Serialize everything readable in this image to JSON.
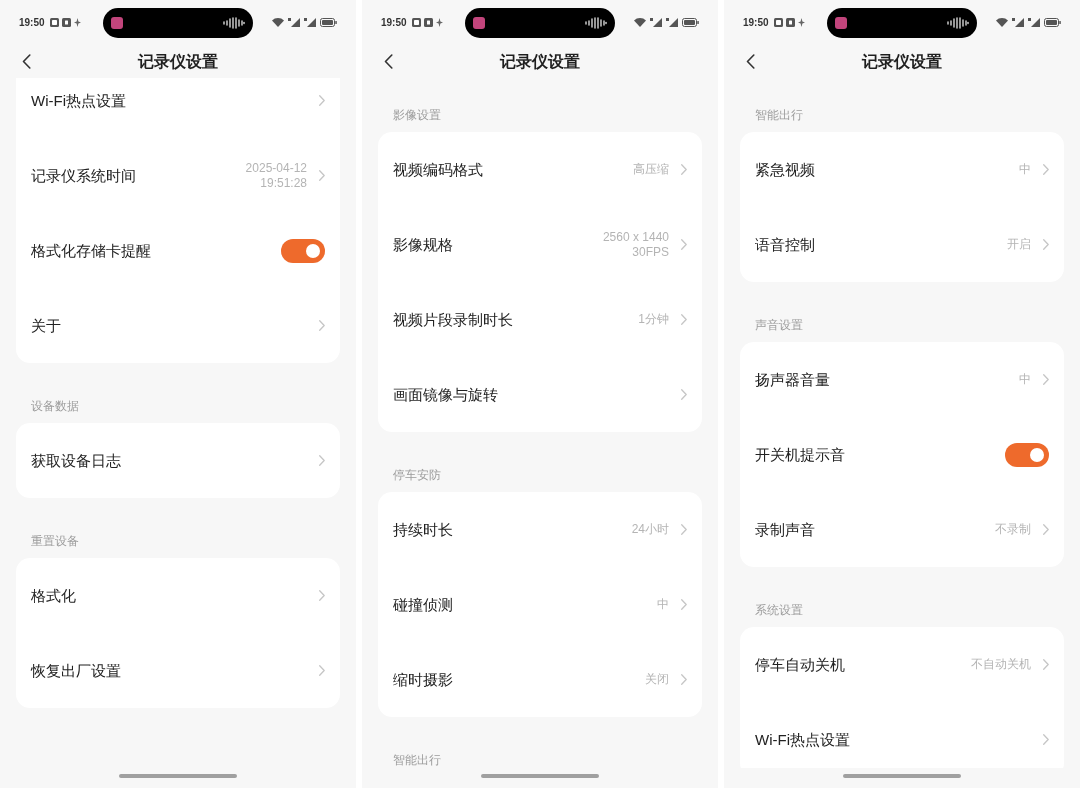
{
  "screens": [
    {
      "status_bar": {
        "time": "19:50"
      },
      "header": {
        "title": "记录仪设置"
      },
      "sections": [
        {
          "continued": true,
          "items": [
            {
              "kind": "link",
              "label": "Wi-Fi热点设置"
            },
            {
              "kind": "link",
              "label": "记录仪系统时间",
              "value": "2025-04-12\n19:51:28"
            },
            {
              "kind": "toggle",
              "label": "格式化存储卡提醒",
              "on": true
            },
            {
              "kind": "link",
              "label": "关于"
            }
          ]
        },
        {
          "title": "设备数据",
          "items": [
            {
              "kind": "link",
              "label": "获取设备日志"
            }
          ]
        },
        {
          "title": "重置设备",
          "items": [
            {
              "kind": "link",
              "label": "格式化"
            },
            {
              "kind": "link",
              "label": "恢复出厂设置"
            }
          ]
        }
      ]
    },
    {
      "status_bar": {
        "time": "19:50"
      },
      "header": {
        "title": "记录仪设置"
      },
      "sections": [
        {
          "title": "影像设置",
          "items": [
            {
              "kind": "link",
              "label": "视频编码格式",
              "value": "高压缩"
            },
            {
              "kind": "link",
              "label": "影像规格",
              "value": "2560 x 1440\n30FPS"
            },
            {
              "kind": "link",
              "label": "视频片段录制时长",
              "value": "1分钟"
            },
            {
              "kind": "link",
              "label": "画面镜像与旋转"
            }
          ]
        },
        {
          "title": "停车安防",
          "items": [
            {
              "kind": "link",
              "label": "持续时长",
              "value": "24小时"
            },
            {
              "kind": "link",
              "label": "碰撞侦测",
              "value": "中"
            },
            {
              "kind": "link",
              "label": "缩时摄影",
              "value": "关闭"
            }
          ]
        },
        {
          "title": "智能出行"
        }
      ]
    },
    {
      "status_bar": {
        "time": "19:50"
      },
      "header": {
        "title": "记录仪设置"
      },
      "sections": [
        {
          "title": "智能出行",
          "items": [
            {
              "kind": "link",
              "label": "紧急视频",
              "value": "中"
            },
            {
              "kind": "link",
              "label": "语音控制",
              "value": "开启"
            }
          ]
        },
        {
          "title": "声音设置",
          "items": [
            {
              "kind": "link",
              "label": "扬声器音量",
              "value": "中"
            },
            {
              "kind": "toggle",
              "label": "开关机提示音",
              "on": true
            },
            {
              "kind": "link",
              "label": "录制声音",
              "value": "不录制"
            }
          ]
        },
        {
          "title": "系统设置",
          "items": [
            {
              "kind": "link",
              "label": "停车自动关机",
              "value": "不自动关机"
            },
            {
              "kind": "link",
              "label": "Wi-Fi热点设置"
            }
          ]
        }
      ]
    }
  ]
}
